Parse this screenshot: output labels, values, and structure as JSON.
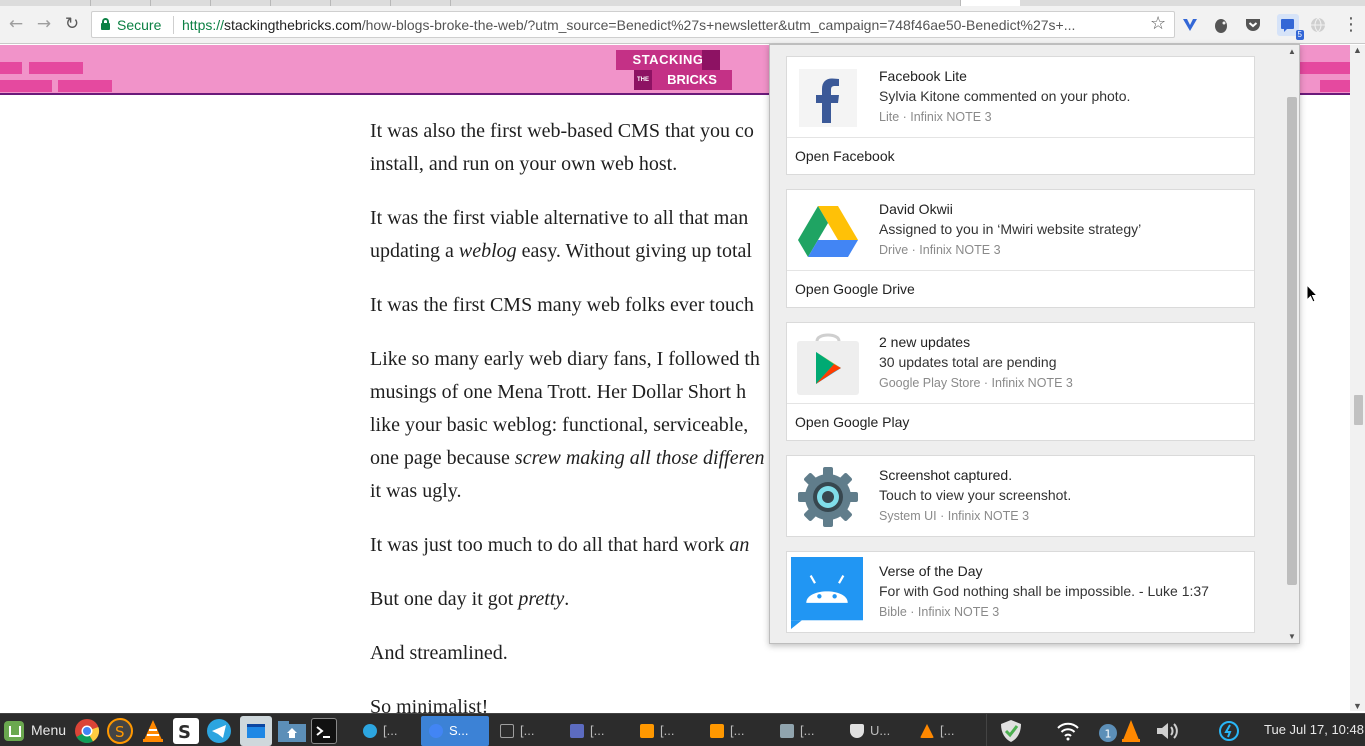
{
  "browser": {
    "secure_label": "Secure",
    "url_scheme": "https://",
    "url_host": "stackingthebricks.com",
    "url_rest": "/how-blogs-broke-the-web/?utm_source=Benedict%27s+newsletter&utm_campaign=748f46ae50-Benedict%27s+...",
    "extension_badge": "5"
  },
  "site": {
    "logo_line1": "STACKING",
    "logo_the": "THE",
    "logo_line2": "BRICKS"
  },
  "article": {
    "p1_l1": "It was also the first web-based CMS that you co",
    "p1_l2": "install, and run on your own web host.",
    "p2_l1": "It was the first viable alternative to all that man",
    "p2_l2a": "updating a ",
    "p2_l2em": "weblog",
    "p2_l2b": " easy. Without giving up total",
    "p3": "It was the first CMS many web folks ever touch",
    "p4_l1": "Like so many early web diary fans, I followed th",
    "p4_l2": "musings of one Mena Trott. Her Dollar Short h",
    "p4_l3": "like your basic weblog: functional, serviceable,",
    "p4_l4a": "one page because ",
    "p4_l4em": "screw making all those differen",
    "p4_l5": "it was ugly.",
    "p5a": "It was just too much to do all that hard work ",
    "p5em": "an",
    "p6a": "But one day it got ",
    "p6em": "pretty",
    "p6b": ".",
    "p7": "And streamlined.",
    "p8": "So minimalist!"
  },
  "notifications": [
    {
      "title": "Facebook Lite",
      "message": "Sylvia Kitone commented on your photo.",
      "source": "Lite · Infinix NOTE 3",
      "action": "Open Facebook",
      "icon": "facebook-icon"
    },
    {
      "title": "David Okwii",
      "message": "Assigned to you in ‘Mwiri website strategy’",
      "source": "Drive · Infinix NOTE 3",
      "action": "Open Google Drive",
      "icon": "google-drive-icon"
    },
    {
      "title": "2 new updates",
      "message": "30 updates total are pending",
      "source": "Google Play Store · Infinix NOTE 3",
      "action": "Open Google Play",
      "icon": "google-play-icon"
    },
    {
      "title": "Screenshot captured.",
      "message": "Touch to view your screenshot.",
      "source": "System UI · Infinix NOTE 3",
      "icon": "settings-gear-icon"
    },
    {
      "title": "Verse of the Day",
      "message": "For with God nothing shall be impossible. - Luke 1:37",
      "source": "Bible · Infinix NOTE 3",
      "icon": "android-chat-icon"
    }
  ],
  "taskbar": {
    "menu_label": "Menu",
    "windows": [
      {
        "label": "[...",
        "icon": "telegram-icon",
        "color": "#2ca5e0"
      },
      {
        "label": "S...",
        "icon": "chrome-icon",
        "color": "#4285f4",
        "active": true
      },
      {
        "label": "[...",
        "icon": "window-icon",
        "color": "#9e9e9e"
      },
      {
        "label": "[...",
        "icon": "text-editor-icon",
        "color": "#5c6bc0"
      },
      {
        "label": "[...",
        "icon": "sublime-icon",
        "color": "#ff9800"
      },
      {
        "label": "[...",
        "icon": "sublime-icon",
        "color": "#ff9800"
      },
      {
        "label": "[...",
        "icon": "folder-icon",
        "color": "#90a4ae"
      },
      {
        "label": "U...",
        "icon": "shield-icon",
        "color": "#e0e0e0"
      },
      {
        "label": "[...",
        "icon": "vlc-icon",
        "color": "#ff8800"
      }
    ],
    "update_badge": "1",
    "clock": "Tue Jul 17, 10:48"
  }
}
